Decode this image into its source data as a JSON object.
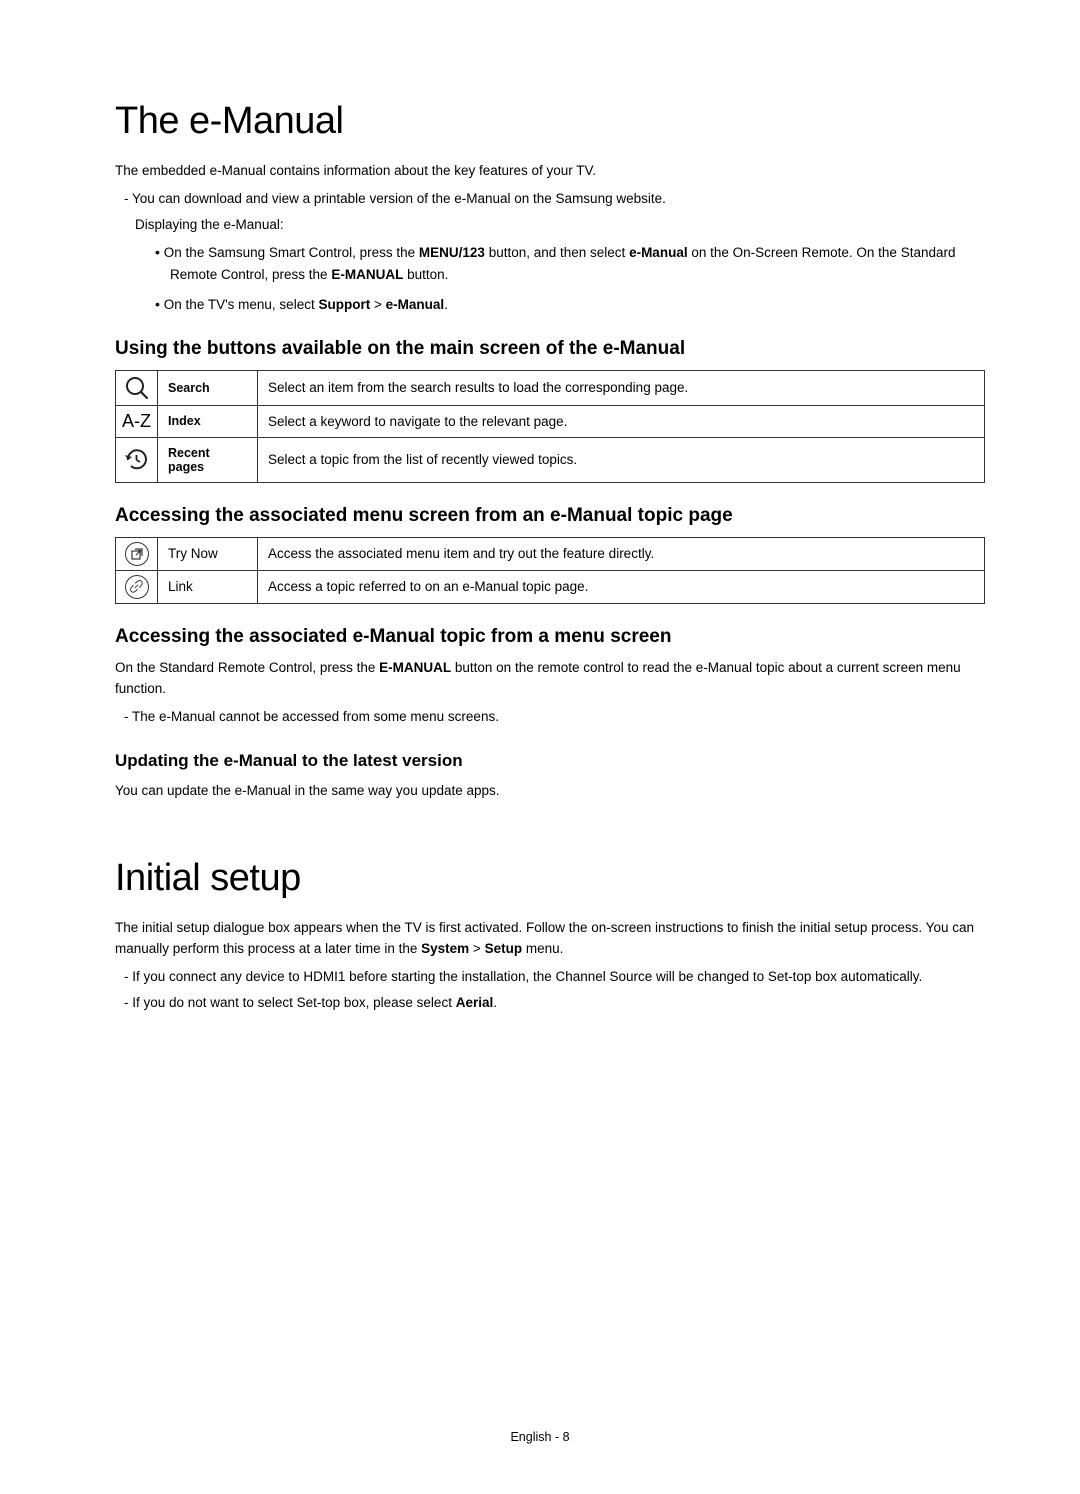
{
  "heading1": "The e-Manual",
  "intro": "The embedded e-Manual contains information about the key features of your TV.",
  "dash1_a": "You can download and view a printable version of the e-Manual on the Samsung website.",
  "dash1_sub": "Displaying the e-Manual:",
  "bullet1_pre": "On the Samsung Smart Control, press the ",
  "bullet1_b1": "MENU/123",
  "bullet1_mid": " button, and then select ",
  "bullet1_b2": "e-Manual",
  "bullet1_post": " on the On-Screen Remote. On the Standard Remote Control, press the ",
  "bullet1_b3": "E-MANUAL",
  "bullet1_end": " button.",
  "bullet2_pre": "On the TV's menu, select ",
  "bullet2_b1": "Support",
  "bullet2_mid": " > ",
  "bullet2_b2": "e-Manual",
  "bullet2_end": ".",
  "h2_1": "Using the buttons available on the main screen of the e-Manual",
  "table1": {
    "r1": {
      "label": "Search",
      "desc": "Select an item from the search results to load the corresponding page."
    },
    "r2": {
      "icon_text": "A-Z",
      "label": "Index",
      "desc": "Select a keyword to navigate to the relevant page."
    },
    "r3": {
      "label": "Recent pages",
      "desc": "Select a topic from the list of recently viewed topics."
    }
  },
  "h2_2": "Accessing the associated menu screen from an e-Manual topic page",
  "table2": {
    "r1": {
      "label": "Try Now",
      "desc": "Access the associated menu item and try out the feature directly."
    },
    "r2": {
      "label": "Link",
      "desc": "Access a topic referred to on an e-Manual topic page."
    }
  },
  "h2_3": "Accessing the associated e-Manual topic from a menu screen",
  "p3_pre": "On the Standard Remote Control, press the ",
  "p3_b": "E-MANUAL",
  "p3_post": " button on the remote control to read the e-Manual topic about a current screen menu function.",
  "dash3": "The e-Manual cannot be accessed from some menu screens.",
  "h3_4": "Updating the e-Manual to the latest version",
  "p4": "You can update the e-Manual in the same way you update apps.",
  "heading2": "Initial setup",
  "is_p_pre": "The initial setup dialogue box appears when the TV is first activated. Follow the on-screen instructions to finish the initial setup process. You can manually perform this process at a later time in the ",
  "is_b1": "System",
  "is_mid": " > ",
  "is_b2": "Setup",
  "is_post": " menu.",
  "is_dash1": "If you connect any device to HDMI1 before starting the installation, the Channel Source will be changed to Set-top box automatically.",
  "is_dash2_pre": "If you do not want to select Set-top box, please select ",
  "is_dash2_b": "Aerial",
  "is_dash2_post": ".",
  "footer_lang": "English",
  "footer_page": "8"
}
